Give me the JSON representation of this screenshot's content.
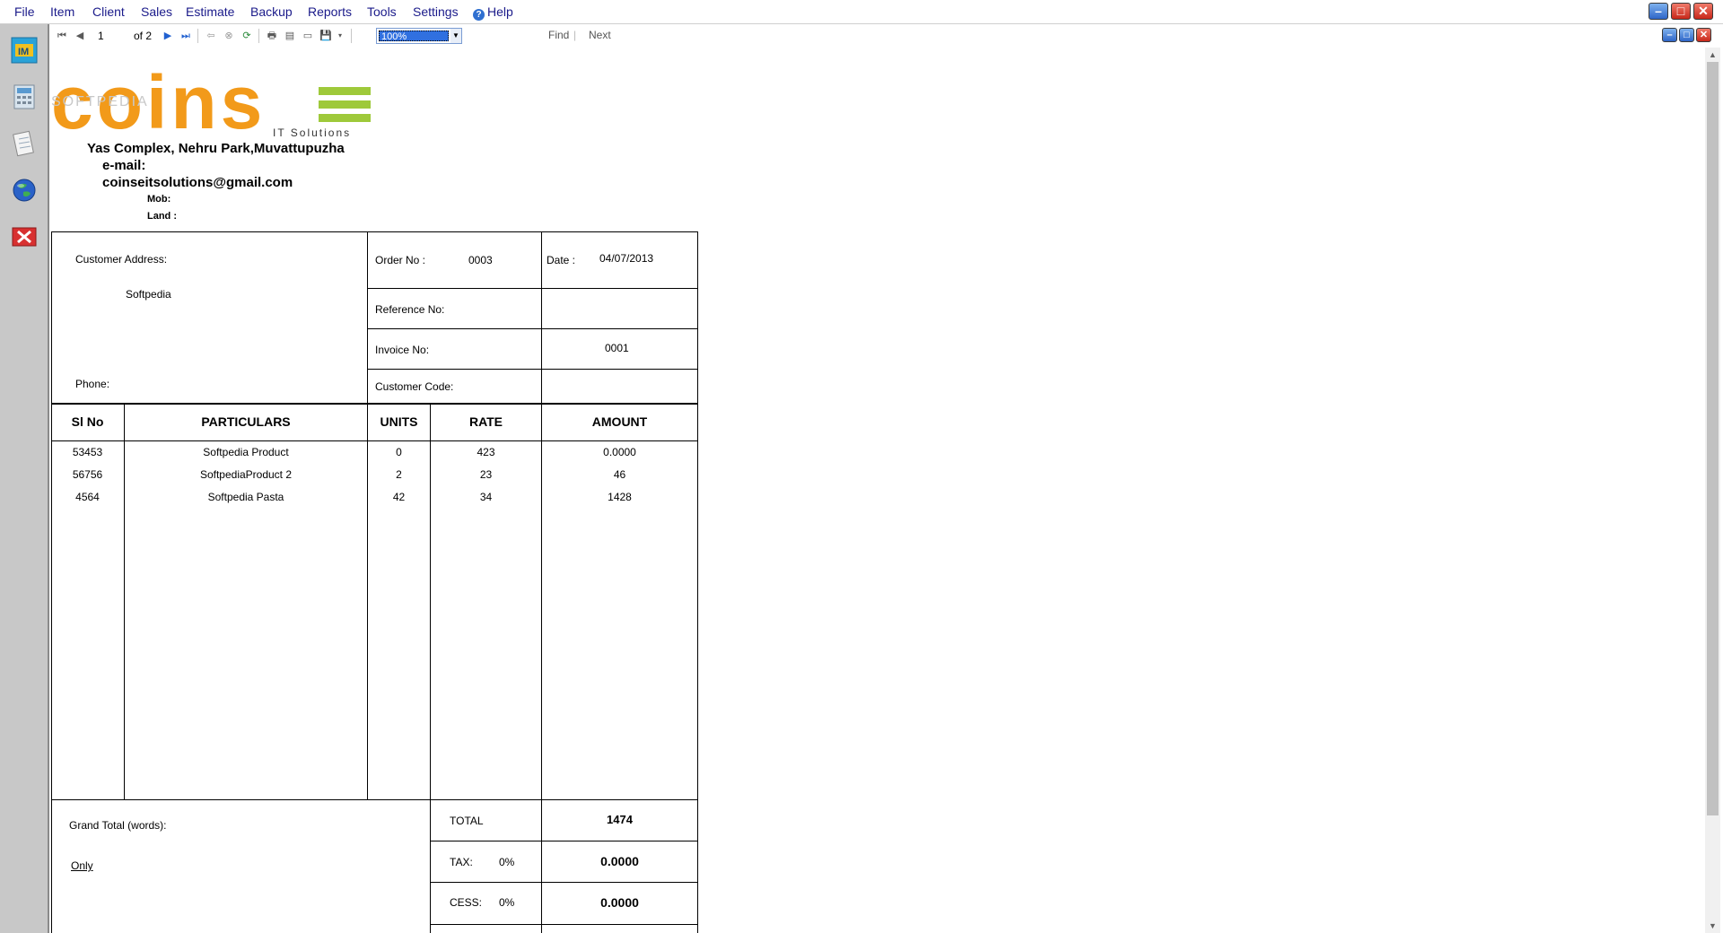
{
  "menu": {
    "file": "File",
    "item": "Item",
    "client": "Client",
    "sales": "Sales",
    "estimate": "Estimate",
    "backup": "Backup",
    "reports": "Reports",
    "tools": "Tools",
    "settings": "Settings",
    "help": "Help"
  },
  "toolbar": {
    "page_current": "1",
    "page_of": "of 2",
    "zoom": "100%",
    "find": "Find",
    "next": "Next"
  },
  "company": {
    "logo_text": "coins",
    "logo_sub": "IT Solutions",
    "watermark": "SOFTPEDIA",
    "address": "Yas Complex, Nehru Park,Muvattupuzha",
    "email_label": "e-mail:",
    "email": "coinseitsolutions@gmail.com",
    "mob_label": "Mob:",
    "land_label": "Land :"
  },
  "invoice": {
    "customer_address_label": "Customer Address:",
    "customer_name": "Softpedia",
    "phone_label": "Phone:",
    "order_no_label": "Order No :",
    "order_no": "0003",
    "date_label": "Date :",
    "date": "04/07/2013",
    "reference_label": "Reference No:",
    "invoice_no_label": "Invoice No:",
    "invoice_no": "0001",
    "customer_code_label": "Customer Code:"
  },
  "table": {
    "headers": [
      "Sl No",
      "PARTICULARS",
      "UNITS",
      "RATE",
      "AMOUNT"
    ],
    "rows": [
      {
        "sl": "53453",
        "particulars": "Softpedia Product",
        "units": "0",
        "rate": "423",
        "amount": "0.0000"
      },
      {
        "sl": "56756",
        "particulars": "SoftpediaProduct 2",
        "units": "2",
        "rate": "23",
        "amount": "46"
      },
      {
        "sl": "4564",
        "particulars": "Softpedia Pasta",
        "units": "42",
        "rate": "34",
        "amount": "1428"
      }
    ]
  },
  "totals": {
    "grand_total_words_label": "Grand Total (words):",
    "only_label": "Only",
    "total_label": "TOTAL",
    "total_value": "1474",
    "tax_label": "TAX:",
    "tax_pct": "0%",
    "tax_value": "0.0000",
    "cess_label": "CESS:",
    "cess_pct": "0%",
    "cess_value": "0.0000"
  }
}
